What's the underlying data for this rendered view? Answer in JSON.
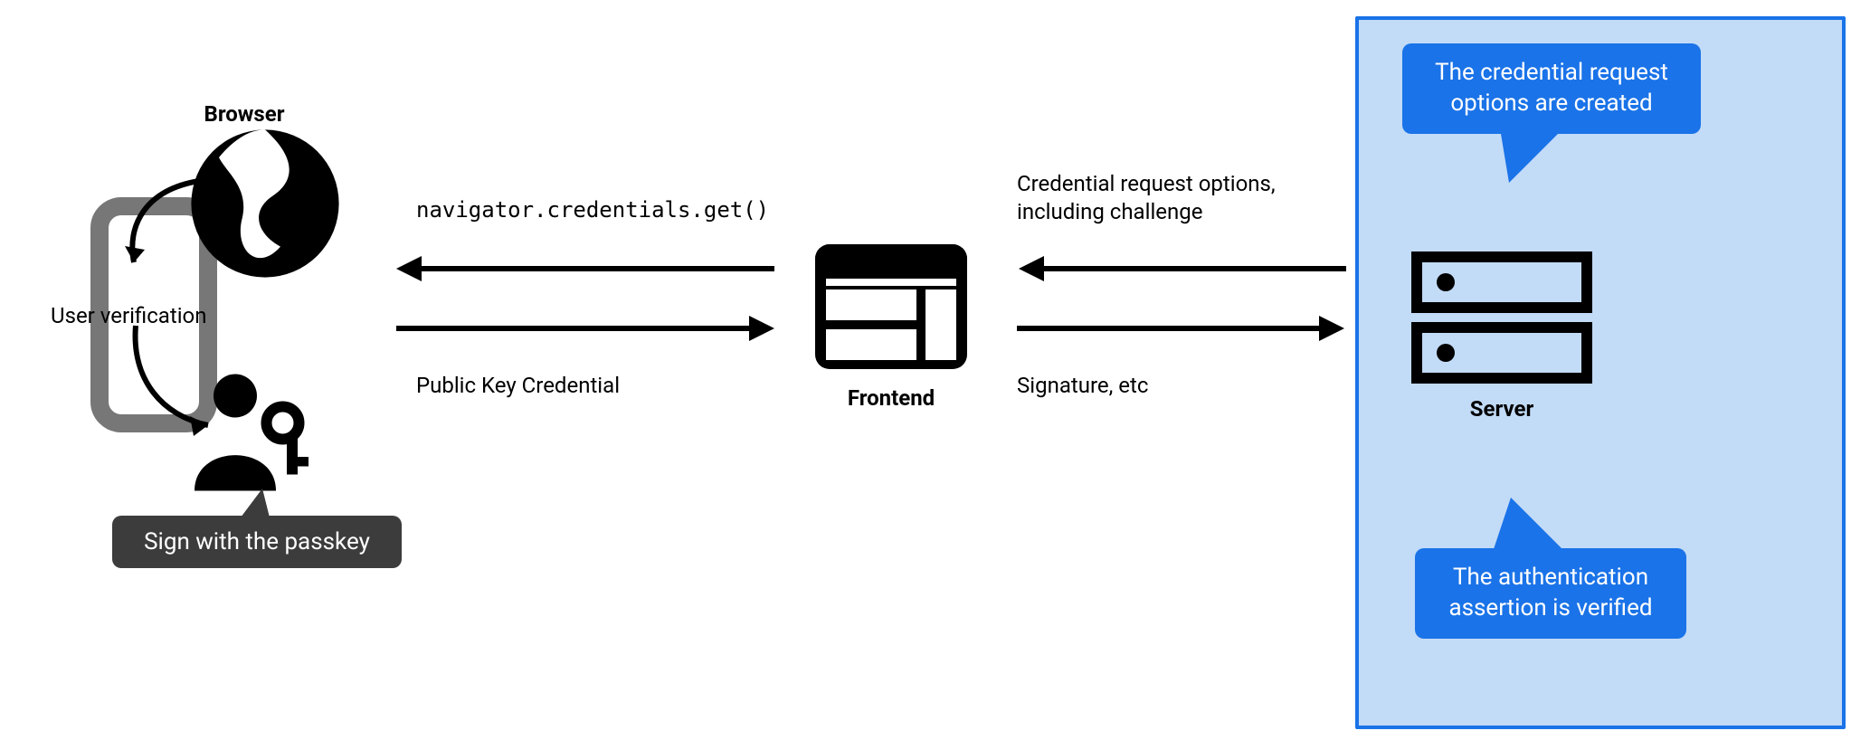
{
  "nodes": {
    "browser": {
      "label": "Browser"
    },
    "frontend": {
      "label": "Frontend"
    },
    "server": {
      "label": "Server"
    }
  },
  "edges": {
    "browser_frontend_top": "navigator.credentials.get()",
    "browser_frontend_bottom": "Public Key Credential",
    "frontend_server_top": "Credential request options, including challenge",
    "frontend_server_bottom": "Signature, etc"
  },
  "callouts": {
    "server_top": "The credential request options are created",
    "server_bottom": "The authentication assertion is verified",
    "browser_user": "Sign with the passkey"
  },
  "side_label": "User verification",
  "colors": {
    "accent": "#1a73e8",
    "server_bg": "#c2dbf7",
    "grey_callout": "#3c3c3c"
  }
}
